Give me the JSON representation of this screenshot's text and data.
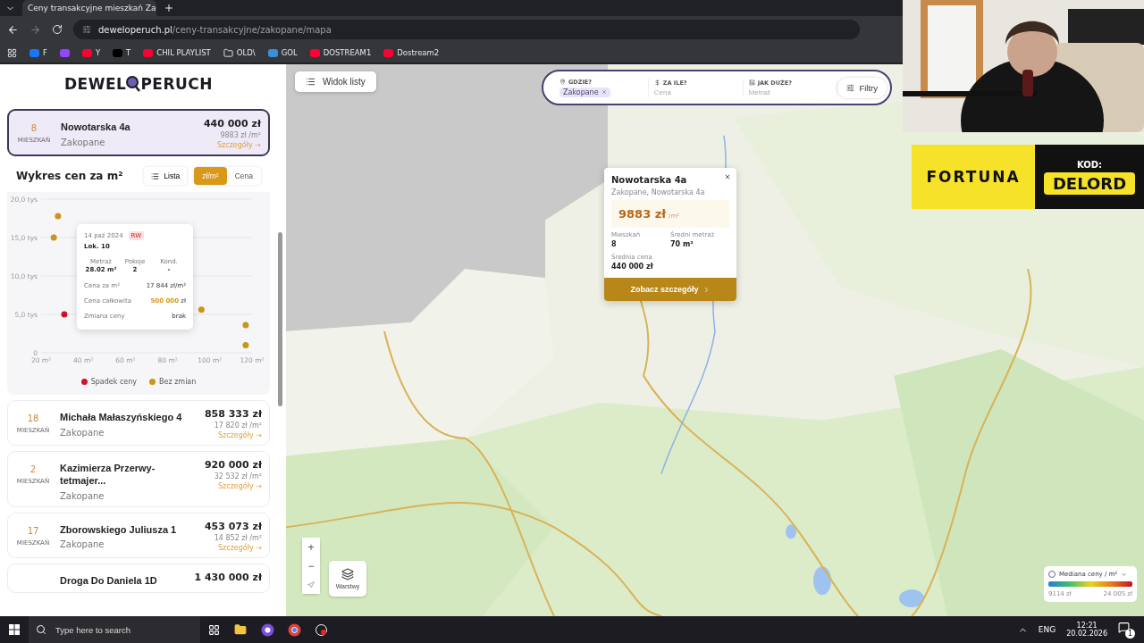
{
  "browser": {
    "tab_title": "Ceny transakcyjne mieszkań Za",
    "url_domain": "deweloperuch.pl",
    "url_path": "/ceny-transakcyjne/zakopane/mapa",
    "bookmarks": [
      {
        "kind": "facebook",
        "label": "F"
      },
      {
        "kind": "twitch"
      },
      {
        "kind": "youtube",
        "label": "Y"
      },
      {
        "kind": "x",
        "label": "T"
      },
      {
        "kind": "youtube",
        "label": "CHIL PLAYLIST"
      },
      {
        "kind": "folder",
        "label": "OLD\\"
      },
      {
        "kind": "g",
        "label": "GOL"
      },
      {
        "kind": "youtube",
        "label": "DOSTREAM1"
      },
      {
        "kind": "youtube",
        "label": "Dostream2"
      }
    ]
  },
  "sidebar": {
    "logo": {
      "before": "DEWEL",
      "after": "PERUCH"
    },
    "listings": [
      {
        "count": "8",
        "unit": "MIESZKAŃ",
        "name": "Nowotarska 4a",
        "city": "Zakopane",
        "price": "440 000 zł",
        "per_m2": "9883 zł /m²",
        "link": "Szczegóły →",
        "selected": true
      },
      {
        "count": "18",
        "unit": "MIESZKAŃ",
        "name": "Michała Małaszyńskiego 4",
        "city": "Zakopane",
        "price": "858 333 zł",
        "per_m2": "17 820 zł /m²",
        "link": "Szczegóły →",
        "selected": false
      },
      {
        "count": "2",
        "unit": "MIESZKAŃ",
        "name": "Kazimierza Przerwy-tetmajer...",
        "city": "Zakopane",
        "price": "920 000 zł",
        "per_m2": "32 532 zł /m²",
        "link": "Szczegóły →",
        "selected": false
      },
      {
        "count": "17",
        "unit": "MIESZKAŃ",
        "name": "Zborowskiego Juliusza 1",
        "city": "Zakopane",
        "price": "453 073 zł",
        "per_m2": "14 852 zł /m²",
        "link": "Szczegóły →",
        "selected": false
      },
      {
        "name": "Droga Do Daniela 1D",
        "price": "1 430 000 zł",
        "selected": false
      }
    ],
    "chart_panel": {
      "title": "Wykres cen za m²",
      "list_button": "Lista",
      "units": [
        {
          "label": "zł/m²",
          "selected": true
        },
        {
          "label": "Cena",
          "selected": false
        }
      ],
      "chart_data": {
        "type": "scatter",
        "grid": true,
        "xlim": [
          20,
          120
        ],
        "ylim": [
          0,
          20
        ],
        "x": [
          26,
          28,
          31,
          96,
          117,
          117
        ],
        "xticks": [
          {
            "value": 20,
            "label": "20 m²"
          },
          {
            "value": 40,
            "label": "40 m²"
          },
          {
            "value": 60,
            "label": "60 m²"
          },
          {
            "value": 80,
            "label": "80 m²"
          },
          {
            "value": 100,
            "label": "100 m²"
          },
          {
            "value": 120,
            "label": "120 m²"
          }
        ],
        "yticks": [
          {
            "value": 0,
            "label": "0"
          },
          {
            "value": 5,
            "label": "5,0 tys"
          },
          {
            "value": 10,
            "label": "10,0 tys"
          },
          {
            "value": 15,
            "label": "15,0 tys"
          },
          {
            "value": 20,
            "label": "20,0 tys"
          }
        ],
        "series": [
          {
            "name": "Spadek ceny",
            "color": "#d0112b",
            "values": [
              null,
              null,
              5.0,
              null,
              null,
              null
            ]
          },
          {
            "name": "Bez zmian",
            "color": "#c8961a",
            "values": [
              15.0,
              17.8,
              null,
              5.6,
              3.6,
              1.0
            ]
          }
        ]
      },
      "tooltip": {
        "date": "14 paź 2024",
        "badge": "RW",
        "unit": "Lok. 10",
        "stats": [
          {
            "label": "Metraż",
            "value": "28.02 m²"
          },
          {
            "label": "Pokoje",
            "value": "2"
          },
          {
            "label": "Kond.",
            "value": "-"
          }
        ],
        "rows": [
          {
            "label": "Cena za m²",
            "value": "17 844",
            "suffix": "zł/m²",
            "highlight": false
          },
          {
            "label": "Cena całkowita",
            "value": "500 000",
            "suffix": "zł",
            "highlight": true
          },
          {
            "label": "Zmiana ceny",
            "value": "brak",
            "highlight": false
          }
        ]
      }
    }
  },
  "map": {
    "list_view_button": "Widok listy",
    "search": [
      {
        "label": "GDZIE?",
        "kind": "place",
        "chip": "Zakopane"
      },
      {
        "label": "ZA ILE?",
        "kind": "price",
        "placeholder": "Cena"
      },
      {
        "label": "JAK DUŻE?",
        "kind": "size",
        "placeholder": "Metraż"
      }
    ],
    "filters_button": "Filtry",
    "popup": {
      "title": "Nowotarska 4a",
      "address": "Zakopane, Nowotarska 4a",
      "price": "9883 zł",
      "price_unit": "/m²",
      "stats": [
        {
          "label": "Mieszkań",
          "value": "8"
        },
        {
          "label": "Średni metraż",
          "value": "70 m²"
        },
        {
          "label": "Średnia cena",
          "value": "440 000 zł"
        }
      ],
      "button": "Zobacz szczegóły"
    },
    "zoom_in": "+",
    "zoom_out": "−",
    "layers_button": "Warstwy",
    "legend": {
      "title": "Mediana ceny / m²",
      "min": "9114 zł",
      "max": "24 005 zł"
    }
  },
  "stream_overlay": {
    "brand": "FORTUNA",
    "code_label": "KOD:",
    "code": "DELORD"
  },
  "taskbar": {
    "search_placeholder": "Type here to search",
    "language": "ENG",
    "time": "12:21",
    "date": "20.02.2026",
    "notifications": "1"
  }
}
